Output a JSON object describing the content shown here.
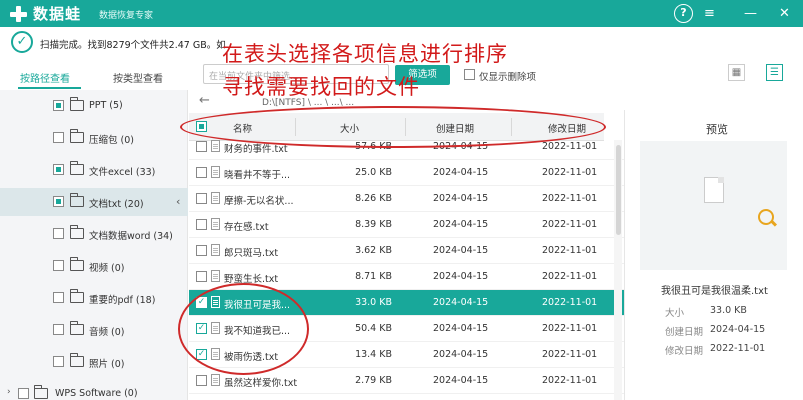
{
  "app": {
    "brand": "数据蛙",
    "subtitle": "数据恢复专家",
    "help_label": "?",
    "menu_label": "≡",
    "minimize_label": "—",
    "close_label": "✕"
  },
  "status": {
    "text": "扫描完成。找到8279个文件共2.47 GB。如..."
  },
  "annotation": {
    "line1": "在表头选择各项信息进行排序",
    "line2": "寻找需要找回的文件"
  },
  "left_panel": {
    "tabs": [
      {
        "label": "按路径查看",
        "active": true
      },
      {
        "label": "按类型查看",
        "active": false
      }
    ],
    "items": [
      {
        "label": "PPT (5)",
        "check": "partial",
        "selected": false
      },
      {
        "label": "压缩包 (0)",
        "check": "none",
        "selected": false
      },
      {
        "label": "文件excel (33)",
        "check": "partial",
        "selected": false
      },
      {
        "label": "文档txt (20)",
        "check": "partial",
        "selected": true
      },
      {
        "label": "文档数据word (34)",
        "check": "none",
        "selected": false
      },
      {
        "label": "视频 (0)",
        "check": "none",
        "selected": false
      },
      {
        "label": "重要的pdf (18)",
        "check": "none",
        "selected": false
      },
      {
        "label": "音频 (0)",
        "check": "none",
        "selected": false
      },
      {
        "label": "照片 (0)",
        "check": "none",
        "selected": false
      },
      {
        "label": "WPS Software (0)",
        "check": "none",
        "selected": false
      }
    ],
    "expand_icon": "›",
    "collapse_icon": "‹"
  },
  "toolbar": {
    "filter_placeholder": "在当前文件夹中筛选...",
    "filter_button": "筛选项",
    "show_deleted_label": "仅显示删除项",
    "view_grid_icon": "▦",
    "view_list_icon": "☰",
    "back_icon": "←",
    "path": "D:\\[NTFS]  \\  ...  \\  ...\\  ..."
  },
  "table": {
    "columns": [
      "名称",
      "大小",
      "创建日期",
      "修改日期"
    ],
    "rows": [
      {
        "name": "财务的事件.txt",
        "size": "57.6 KB",
        "created": "2024-04-15",
        "modified": "2022-11-01",
        "checked": false,
        "selected": false
      },
      {
        "name": "晓看井不等于...",
        "size": "25.0 KB",
        "created": "2024-04-15",
        "modified": "2022-11-01",
        "checked": false,
        "selected": false
      },
      {
        "name": "摩擦-无以名状...",
        "size": "8.26 KB",
        "created": "2024-04-15",
        "modified": "2022-11-01",
        "checked": false,
        "selected": false
      },
      {
        "name": "存在感.txt",
        "size": "8.39 KB",
        "created": "2024-04-15",
        "modified": "2022-11-01",
        "checked": false,
        "selected": false
      },
      {
        "name": "郎只斑马.txt",
        "size": "3.62 KB",
        "created": "2024-04-15",
        "modified": "2022-11-01",
        "checked": false,
        "selected": false
      },
      {
        "name": "野蛮生长.txt",
        "size": "8.71 KB",
        "created": "2024-04-15",
        "modified": "2022-11-01",
        "checked": false,
        "selected": false
      },
      {
        "name": "我很丑可是我...",
        "size": "33.0 KB",
        "created": "2024-04-15",
        "modified": "2022-11-01",
        "checked": true,
        "selected": true
      },
      {
        "name": "我不知道我已...",
        "size": "50.4 KB",
        "created": "2024-04-15",
        "modified": "2022-11-01",
        "checked": true,
        "selected": false
      },
      {
        "name": "被雨伤透.txt",
        "size": "13.4 KB",
        "created": "2024-04-15",
        "modified": "2022-11-01",
        "checked": true,
        "selected": false
      },
      {
        "name": "虽然这样爱你.txt",
        "size": "2.79 KB",
        "created": "2024-04-15",
        "modified": "2022-11-01",
        "checked": false,
        "selected": false
      }
    ]
  },
  "preview": {
    "title": "预览",
    "file_name": "我很丑可是我很温柔.txt",
    "fields": [
      {
        "label": "大小",
        "value": "33.0 KB"
      },
      {
        "label": "创建日期",
        "value": "2024-04-15"
      },
      {
        "label": "修改日期",
        "value": "2022-11-01"
      }
    ]
  }
}
